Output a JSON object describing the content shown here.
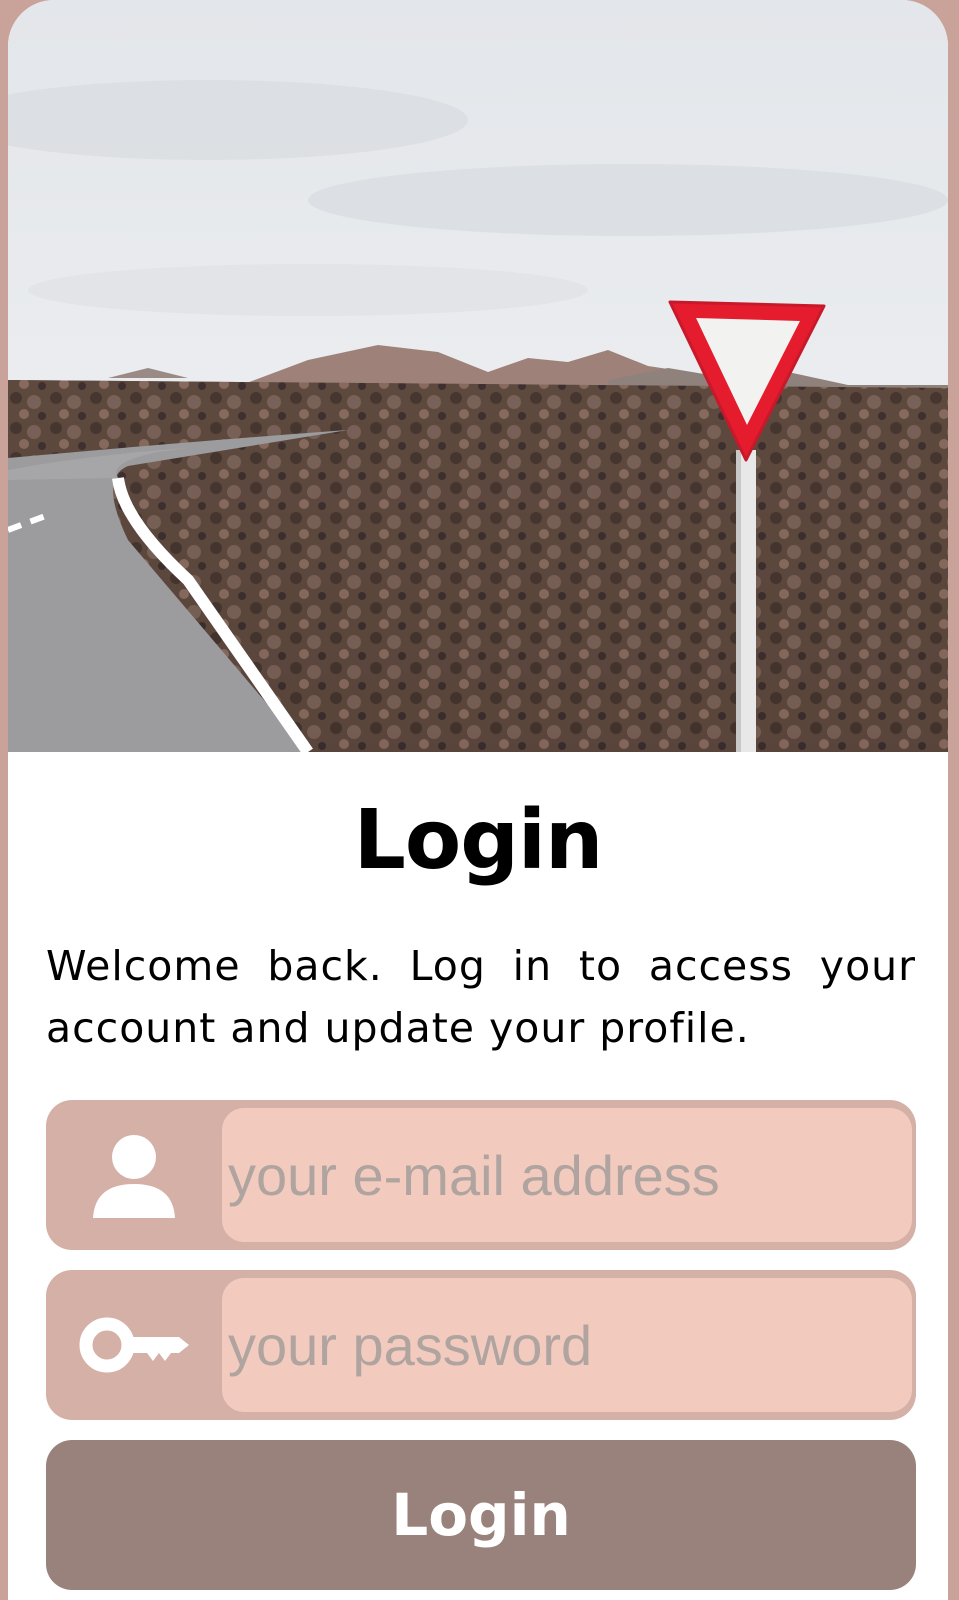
{
  "login": {
    "title": "Login",
    "description": "Welcome back. Log in to access your account and update your profile.",
    "email_placeholder": "your e-mail address",
    "password_placeholder": "your password",
    "submit_label": "Login"
  },
  "icons": {
    "email": "user-icon",
    "password": "key-icon"
  },
  "colors": {
    "page_background": "#c9a39a",
    "field_frame": "#d4b0a6",
    "field_input": "#f3cbbe",
    "button": "#9a827c",
    "placeholder": "#b0a4a0"
  }
}
